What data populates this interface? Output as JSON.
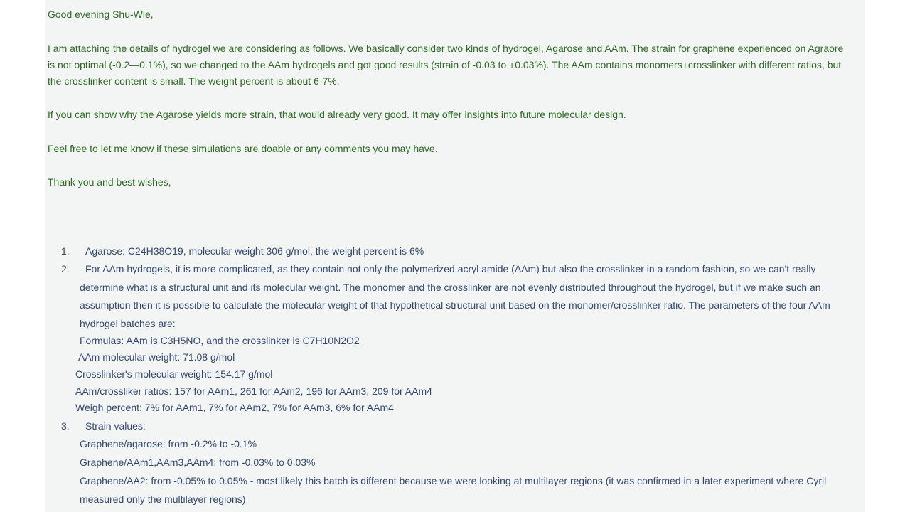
{
  "greeting": "Good evening Shu-Wie,",
  "paragraph1": {
    "line1": "I am attaching the details of hydrogel we are considering as follows. We basically consider two kinds of hydrogel, Agarose and AAm. The strain for graphene experienced on Agraore",
    "line2": "is not optimal (-0.2—0.1%), so we changed to the AAm hydrogels and got good results (strain of -0.03 to +0.03%). The AAm contains monomers+crosslinker with different ratios, but",
    "line3": "the crosslinker content is small. The weight percent is about 6-7%."
  },
  "paragraph2": "If you can show why the Agarose yields more strain, that would already very good. It may offer insights into future molecular design.",
  "paragraph3": "Feel free to let me know if these simulations are doable or any comments you may have.",
  "closing": "Thank you and best wishes,",
  "list": {
    "item1": {
      "number": "1.",
      "text": "Agarose: C24H38O19, molecular weight 306 g/mol, the weight percent is 6%"
    },
    "item2": {
      "number": "2.",
      "line1": "For AAm hydrogels, it is more complicated, as they contain not only the polymerized acryl amide (AAm) but also the crosslinker in a random fashion, so we can't really",
      "line2": "determine what is a structural unit and its molecular weight. The monomer and the crosslinker are not evenly distributed throughout the hydrogel, but if we make such an",
      "line3": "assumption then it is possible to calculate the molecular weight of that hypothetical structural unit based on the monomer/crosslinker ratio. The parameters of the four AAm",
      "line4": "hydrogel batches are:",
      "formulas": "Formulas: AAm is C3H5NO, and the crosslinker is C7H10N2O2",
      "aam_weight": "AAm molecular weight: 71.08 g/mol",
      "crosslinker_weight": "Crosslinker's molecular weight: 154.17 g/mol",
      "ratios": "AAm/crossliker ratios: 157 for AAm1, 261 for AAm2, 196 for AAm3, 209 for AAm4",
      "weigh_percent": "Weigh percent: 7% for AAm1, 7% for AAm2, 7% for AAm3, 6% for AAm4"
    },
    "item3": {
      "number": "3.",
      "text": "Strain values:",
      "agarose": "Graphene/agarose: from -0.2% to -0.1%",
      "aam134": "Graphene/AAm1,AAm3,AAm4: from -0.03% to 0.03%",
      "aa2_line1": "Graphene/AA2: from -0.05% to 0.05%  - most likely this batch is different because we were looking at multilayer regions (it was confirmed in a later experiment where Cyril",
      "aa2_line2": "measured only the multilayer regions)"
    }
  }
}
